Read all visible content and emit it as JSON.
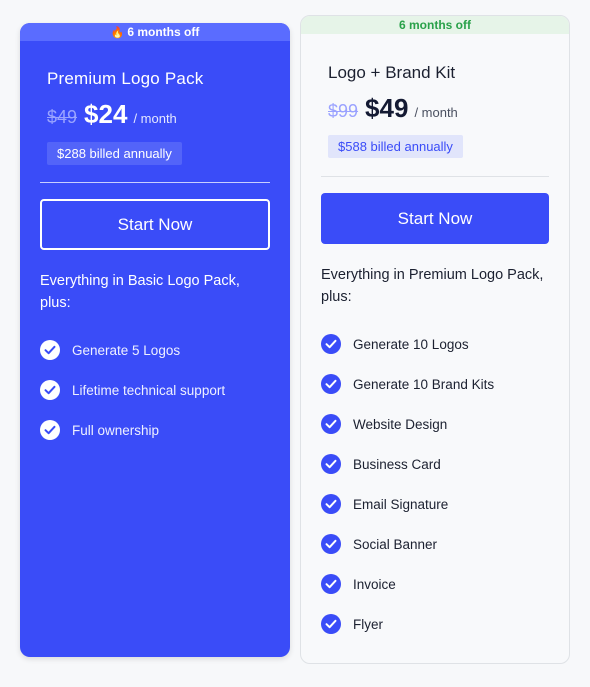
{
  "plans": [
    {
      "ribbon": "6 months off",
      "title": "Premium Logo Pack",
      "old_price": "$49",
      "price": "$24",
      "period": "/ month",
      "billed": "$288 billed annually",
      "cta": "Start Now",
      "intro": "Everything in Basic Logo Pack, plus:",
      "features": [
        "Generate 5 Logos",
        "Lifetime technical support",
        "Full ownership"
      ]
    },
    {
      "ribbon": "6 months off",
      "title": "Logo + Brand Kit",
      "old_price": "$99",
      "price": "$49",
      "period": "/ month",
      "billed": "$588 billed annually",
      "cta": "Start Now",
      "intro": "Everything in Premium Logo Pack, plus:",
      "features": [
        "Generate 10 Logos",
        "Generate 10 Brand Kits",
        "Website Design",
        "Business Card",
        "Email Signature",
        "Social Banner",
        "Invoice",
        "Flyer"
      ]
    }
  ],
  "icons": {
    "ribbon_1": "fire-icon",
    "feature": "check-circle-icon"
  },
  "colors": {
    "accent": "#3a4cf8",
    "ribbon_green": "#2aa14a",
    "ribbon_green_bg": "#e6f4e8"
  }
}
